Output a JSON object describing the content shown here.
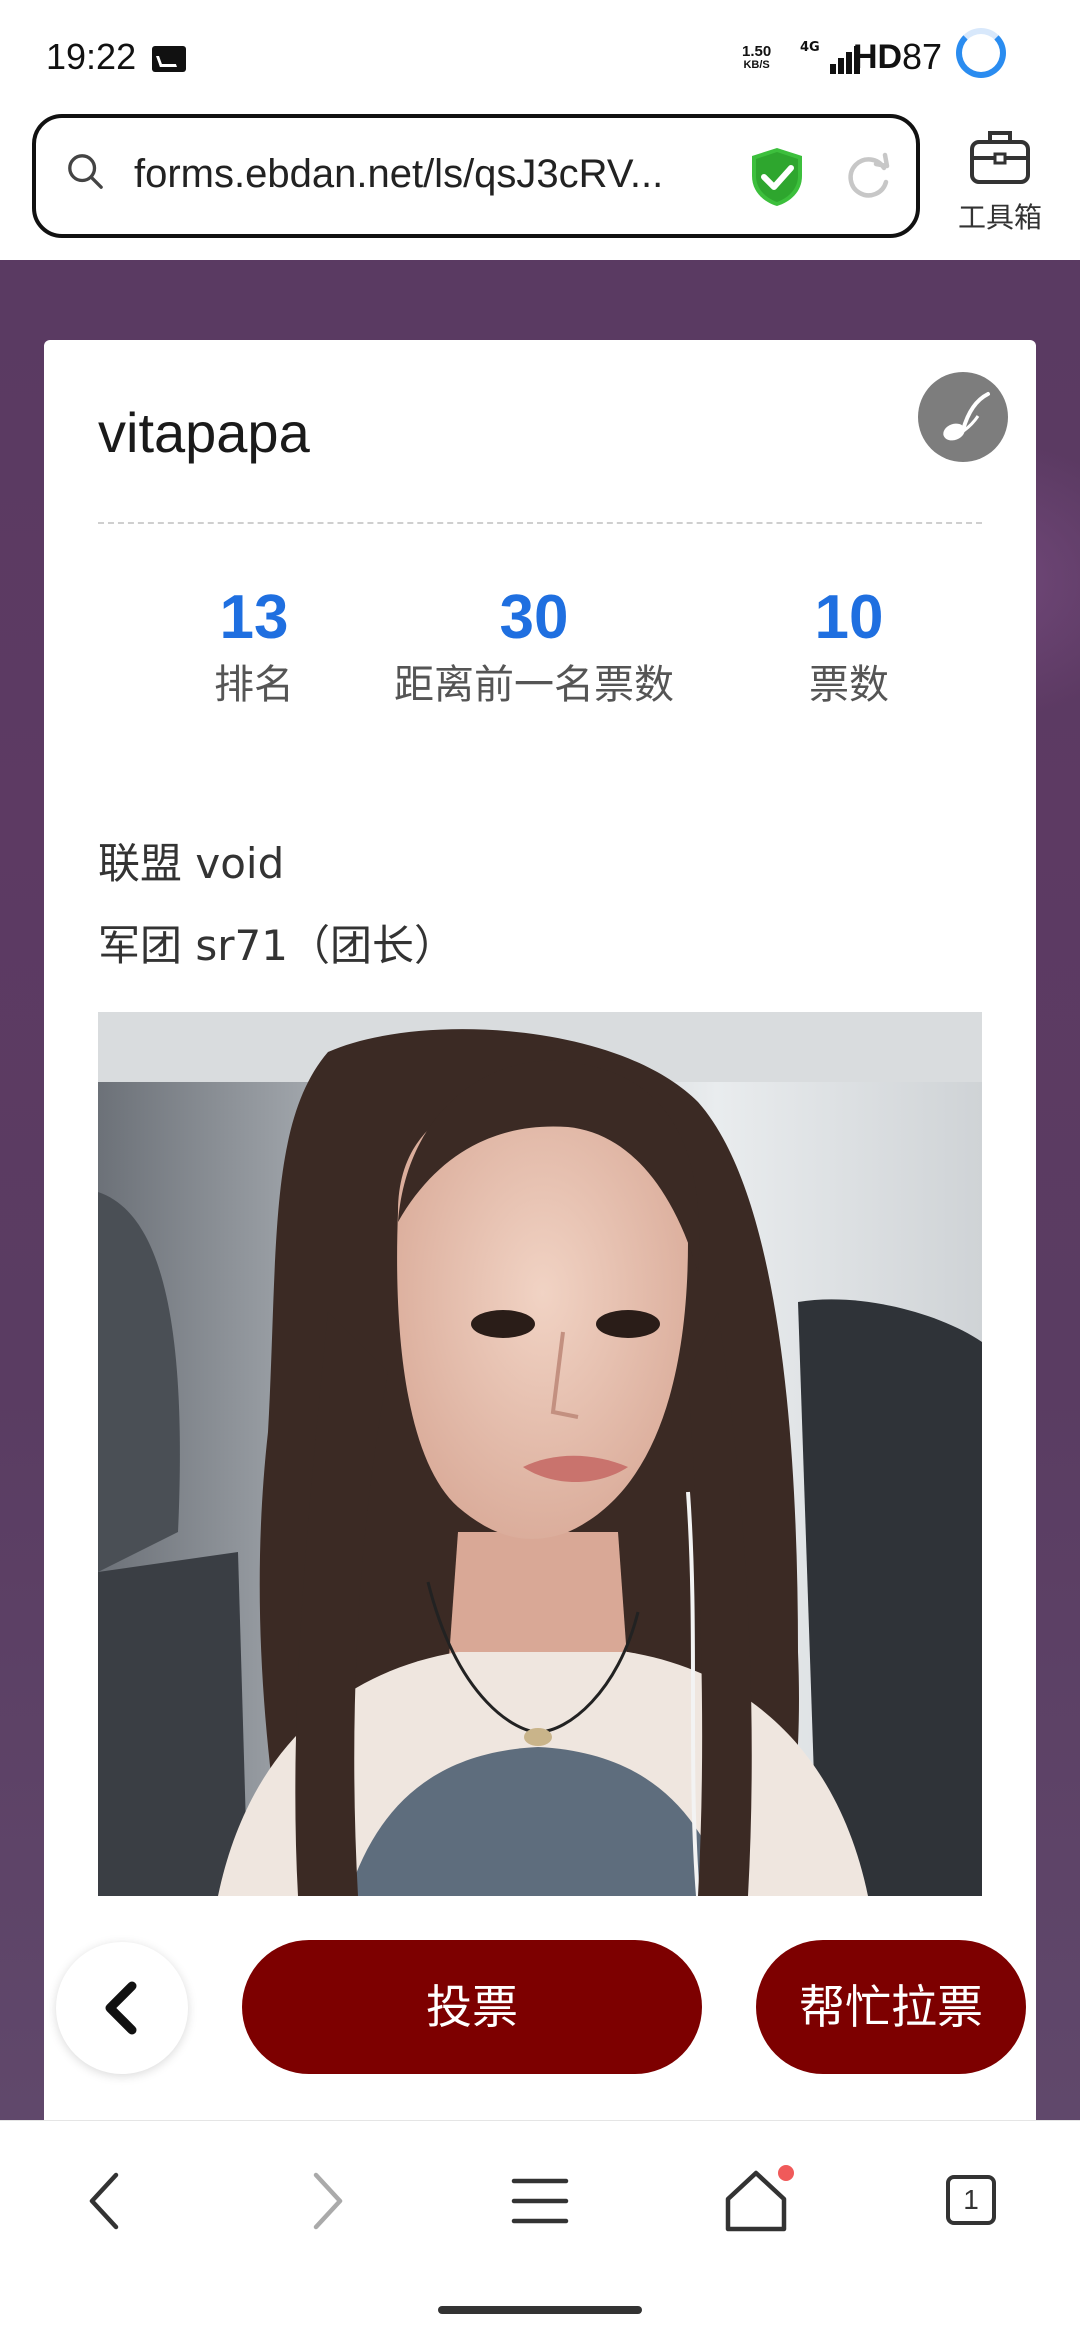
{
  "status_bar": {
    "time": "19:22",
    "net_speed_value": "1.50",
    "net_speed_unit": "KB/S",
    "network": "4G",
    "hd": "HD",
    "battery": "87",
    "icons": [
      "message-icon",
      "signal-icon",
      "battery-ring-icon"
    ]
  },
  "browser": {
    "url": "forms.ebdan.net/ls/qsJ3cRV...",
    "toolbox_label": "工具箱",
    "accent_color": "#2a8cf0",
    "shield_color": "#3cbf3c"
  },
  "profile": {
    "name": "vitapapa",
    "stats": [
      {
        "value": "13",
        "label": "排名"
      },
      {
        "value": "30",
        "label": "距离前一名票数"
      },
      {
        "value": "10",
        "label": "票数"
      }
    ],
    "alliance": "联盟 void",
    "legion": "军团 sr71（团长）",
    "stat_color": "#1f6fe0"
  },
  "actions": {
    "vote_label": "投票",
    "canvass_label": "帮忙拉票",
    "button_color": "#7d0000"
  },
  "bottom_nav": {
    "tab_count": "1",
    "icons": [
      "back-icon",
      "forward-icon",
      "menu-icon",
      "home-icon",
      "tabs-icon"
    ]
  }
}
